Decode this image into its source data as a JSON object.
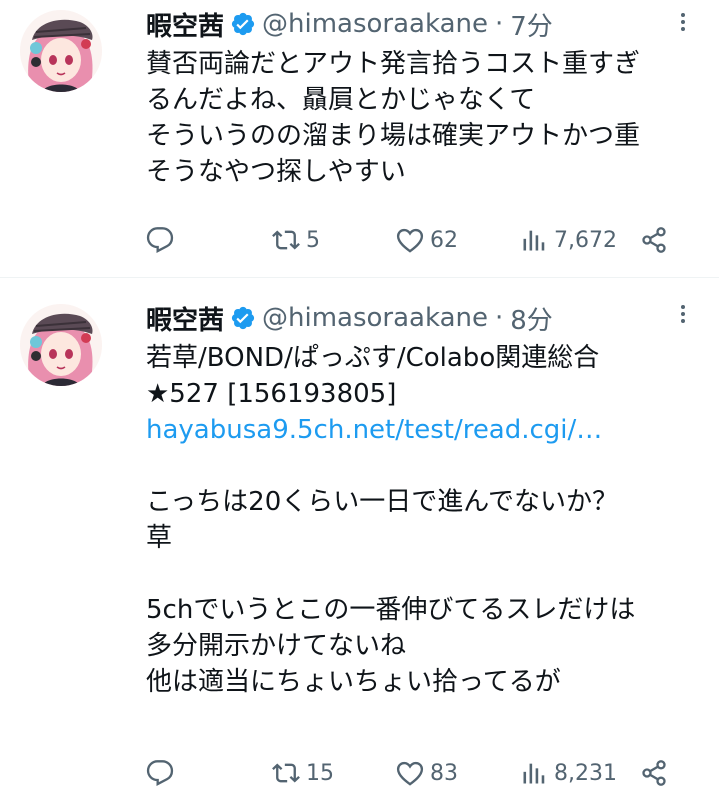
{
  "tweets": [
    {
      "name": "暇空茜",
      "handle": "@himasoraakane",
      "separator": "·",
      "time": "7分",
      "lines": [
        "賛否両論だとアウト発言拾うコスト重すぎ",
        "るんだよね、贔屓とかじゃなくて",
        "そういうのの溜まり場は確実アウトかつ重",
        "そうなやつ探しやすい"
      ],
      "replies": "",
      "retweets": "5",
      "likes": "62",
      "views": "7,672"
    },
    {
      "name": "暇空茜",
      "handle": "@himasoraakane",
      "separator": "·",
      "time": "8分",
      "lines": [
        "若草/BOND/ぱっぷす/Colabo関連総合",
        "★527 [156193805]"
      ],
      "link": "hayabusa9.5ch.net/test/read.cgi/…",
      "lines2": [
        "こっちは20くらい一日で進んでないか？",
        "草"
      ],
      "lines3": [
        "5chでいうとこの一番伸びてるスレだけは",
        "多分開示かけてないね",
        "他は適当にちょいちょい拾ってるが"
      ],
      "replies": "",
      "retweets": "15",
      "likes": "83",
      "views": "8,231"
    }
  ],
  "colors": {
    "text": "#0f1419",
    "muted": "#536471",
    "link": "#1d9bf0",
    "verified": "#1d9bf0",
    "divider": "#eff3f4"
  },
  "icons": [
    "verified-badge-icon",
    "more-icon",
    "reply-icon",
    "retweet-icon",
    "like-icon",
    "views-icon",
    "share-icon"
  ]
}
